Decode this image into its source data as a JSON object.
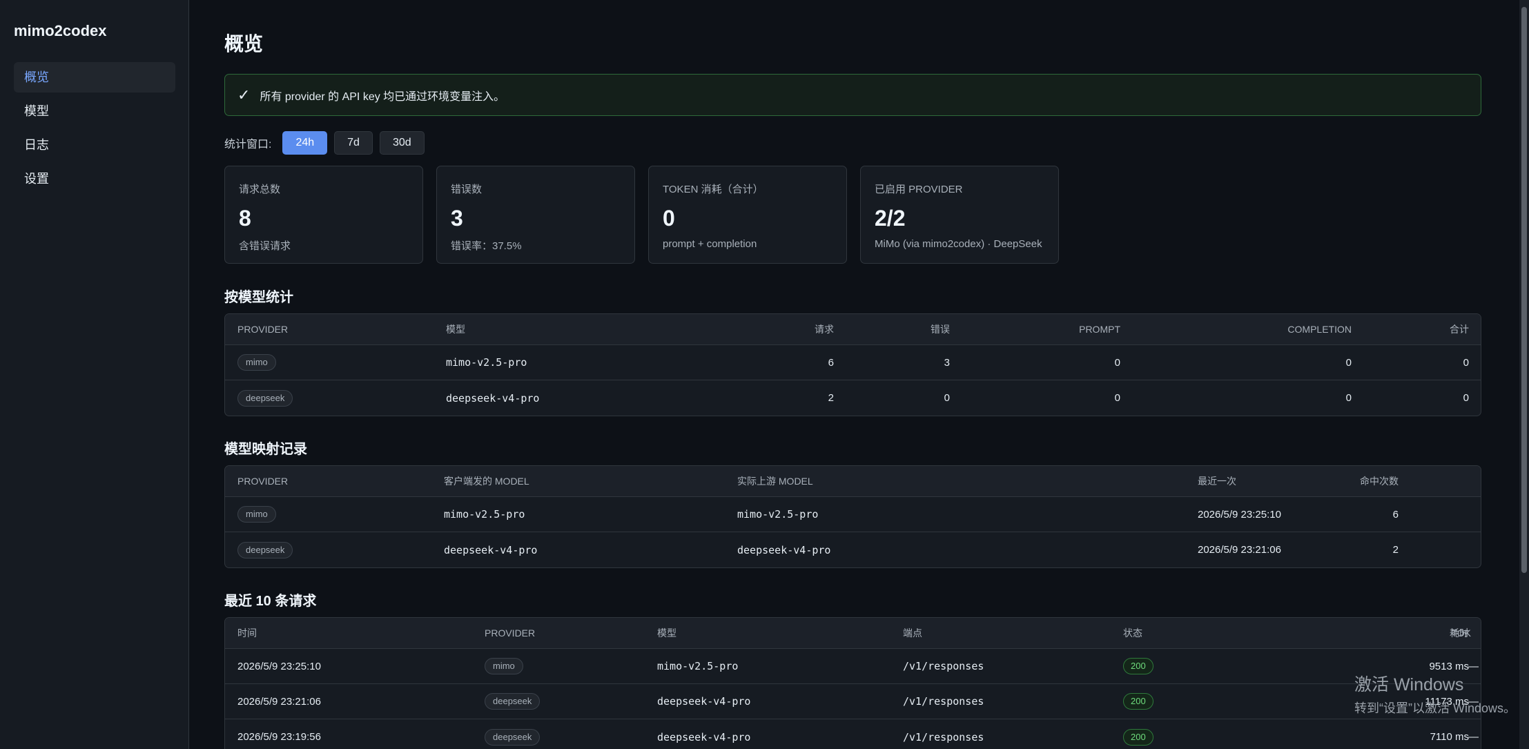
{
  "sidebar": {
    "brand": "mimo2codex",
    "items": [
      {
        "label": "概览",
        "active": true
      },
      {
        "label": "模型",
        "active": false
      },
      {
        "label": "日志",
        "active": false
      },
      {
        "label": "设置",
        "active": false
      }
    ]
  },
  "header": {
    "title": "概览"
  },
  "alert": {
    "icon": "✓",
    "text": "所有 provider 的 API key 均已通过环境变量注入。"
  },
  "window": {
    "label": "统计窗口:",
    "options": [
      "24h",
      "7d",
      "30d"
    ],
    "selected": "24h"
  },
  "cards": [
    {
      "label": "请求总数",
      "value": "8",
      "sub": "含错误请求"
    },
    {
      "label": "错误数",
      "value": "3",
      "sub": "错误率：37.5%"
    },
    {
      "label": "TOKEN 消耗（合计）",
      "value": "0",
      "sub": "prompt + completion"
    },
    {
      "label": "已启用 PROVIDER",
      "value": "2/2",
      "sub": "MiMo (via mimo2codex) · DeepSeek"
    }
  ],
  "by_model": {
    "title": "按模型统计",
    "headers": [
      "PROVIDER",
      "模型",
      "请求",
      "错误",
      "PROMPT",
      "COMPLETION",
      "合计"
    ],
    "rows": [
      {
        "provider": "mimo",
        "model": "mimo-v2.5-pro",
        "requests": "6",
        "errors": "3",
        "prompt": "0",
        "completion": "0",
        "total": "0"
      },
      {
        "provider": "deepseek",
        "model": "deepseek-v4-pro",
        "requests": "2",
        "errors": "0",
        "prompt": "0",
        "completion": "0",
        "total": "0"
      }
    ]
  },
  "mapping": {
    "title": "模型映射记录",
    "headers": [
      "PROVIDER",
      "客户端发的 MODEL",
      "实际上游 MODEL",
      "命中次数",
      "最近一次"
    ],
    "rows": [
      {
        "provider": "mimo",
        "client_model": "mimo-v2.5-pro",
        "upstream_model": "mimo-v2.5-pro",
        "hits": "6",
        "last": "2026/5/9 23:25:10"
      },
      {
        "provider": "deepseek",
        "client_model": "deepseek-v4-pro",
        "upstream_model": "deepseek-v4-pro",
        "hits": "2",
        "last": "2026/5/9 23:21:06"
      }
    ]
  },
  "recent": {
    "title": "最近 10 条请求",
    "headers": [
      "时间",
      "PROVIDER",
      "模型",
      "端点",
      "状态",
      "TOK",
      "耗时"
    ],
    "rows": [
      {
        "time": "2026/5/9 23:25:10",
        "provider": "mimo",
        "model": "mimo-v2.5-pro",
        "endpoint": "/v1/responses",
        "status": "200",
        "tok": "—",
        "duration": "9513 ms"
      },
      {
        "time": "2026/5/9 23:21:06",
        "provider": "deepseek",
        "model": "deepseek-v4-pro",
        "endpoint": "/v1/responses",
        "status": "200",
        "tok": "—",
        "duration": "11173 ms"
      },
      {
        "time": "2026/5/9 23:19:56",
        "provider": "deepseek",
        "model": "deepseek-v4-pro",
        "endpoint": "/v1/responses",
        "status": "200",
        "tok": "—",
        "duration": "7110 ms"
      }
    ]
  },
  "watermark": {
    "title": "激活 Windows",
    "sub": "转到“设置”以激活 Windows。"
  }
}
